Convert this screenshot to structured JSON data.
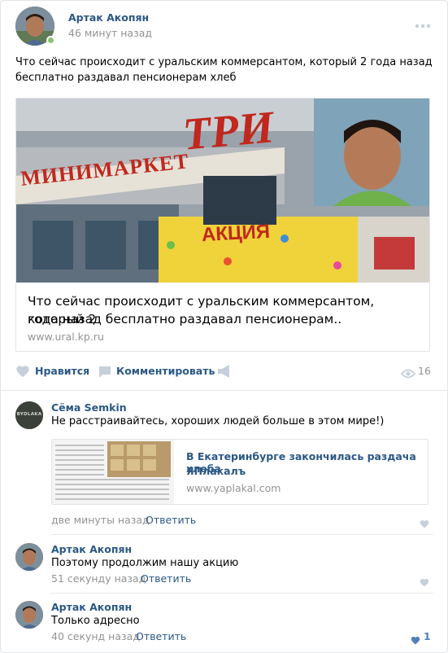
{
  "post": {
    "author": "Артак Акопян",
    "time": "46 минут назад",
    "text_line1": "Что сейчас происходит с уральским коммерсантом, который 2 года назад",
    "text_line2": "бесплатно раздавал пенсионерам хлеб",
    "image": {
      "store_sign": "МИНИМАРКЕТ",
      "store_logo": "ТРИ",
      "promo": "АКЦИЯ"
    },
    "snippet": {
      "title_line1": "Что сейчас происходит с уральским коммерсантом, который 2",
      "title_line2": "года назад бесплатно раздавал пенсионерам..",
      "domain": "www.ural.kp.ru"
    },
    "actions": {
      "like": "Нравится",
      "comment": "Комментировать",
      "views": "16"
    }
  },
  "comments": [
    {
      "author": "Сёма Semkin",
      "text": "Не расстраивайтесь, хороших людей больше в этом мире!)",
      "avatar_label": "BYDLAKA",
      "attachment": {
        "title_line1": "В Екатеринбурге закончилась раздача хлеба -",
        "title_line2": "ЯПлакалъ",
        "domain": "www.yaplakal.com"
      },
      "time": "две минуты назад",
      "reply": "Ответить",
      "likes": ""
    },
    {
      "author": "Артак Акопян",
      "text": "Поэтому продолжим нашу акцию",
      "time": "51 секунду назад",
      "reply": "Ответить",
      "likes": ""
    },
    {
      "author": "Артак Акопян",
      "text": "Только адресно",
      "time": "40 секунд назад",
      "reply": "Ответить",
      "likes": "1"
    }
  ],
  "colors": {
    "link": "#2a5885",
    "muted": "#939393",
    "icon": "#c5d0db",
    "liked_heart": "#5181b8",
    "online": "#8ac176"
  }
}
